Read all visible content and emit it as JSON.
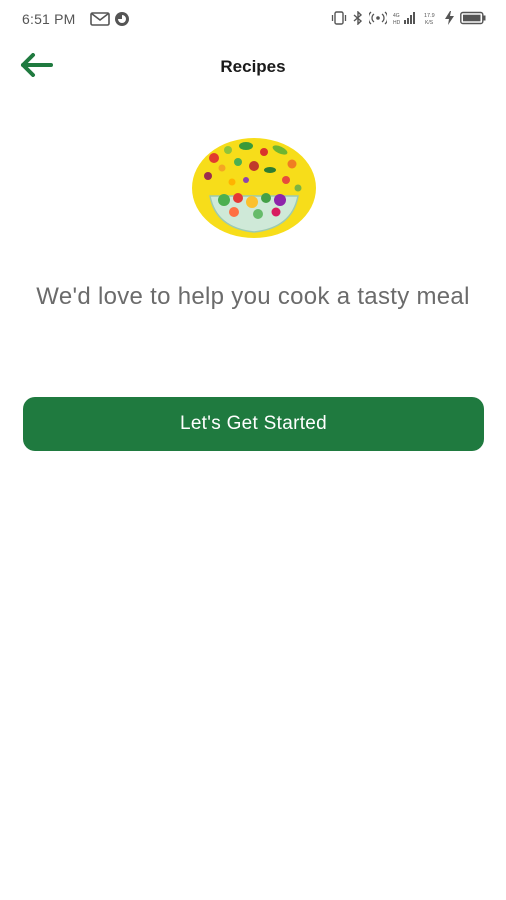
{
  "status_bar": {
    "time": "6:51 PM",
    "left_icons": [
      "gmail-icon",
      "app-notification-icon"
    ],
    "right_icons": [
      "vibrate-icon",
      "bluetooth-icon",
      "hotspot-icon",
      "signal-icon",
      "data-speed-icon",
      "charging-icon",
      "battery-icon"
    ],
    "data_speed": "17.9\nK/S"
  },
  "app_bar": {
    "title": "Recipes",
    "back_icon": "arrow-left-icon"
  },
  "main": {
    "illustration": "salad-bowl-illustration",
    "message": "We'd love to help you cook a tasty meal",
    "button_label": "Let's Get Started"
  },
  "colors": {
    "primary": "#1f7a3f",
    "text_muted": "#6b6b6b",
    "illustration_bg": "#f7dd1a"
  }
}
